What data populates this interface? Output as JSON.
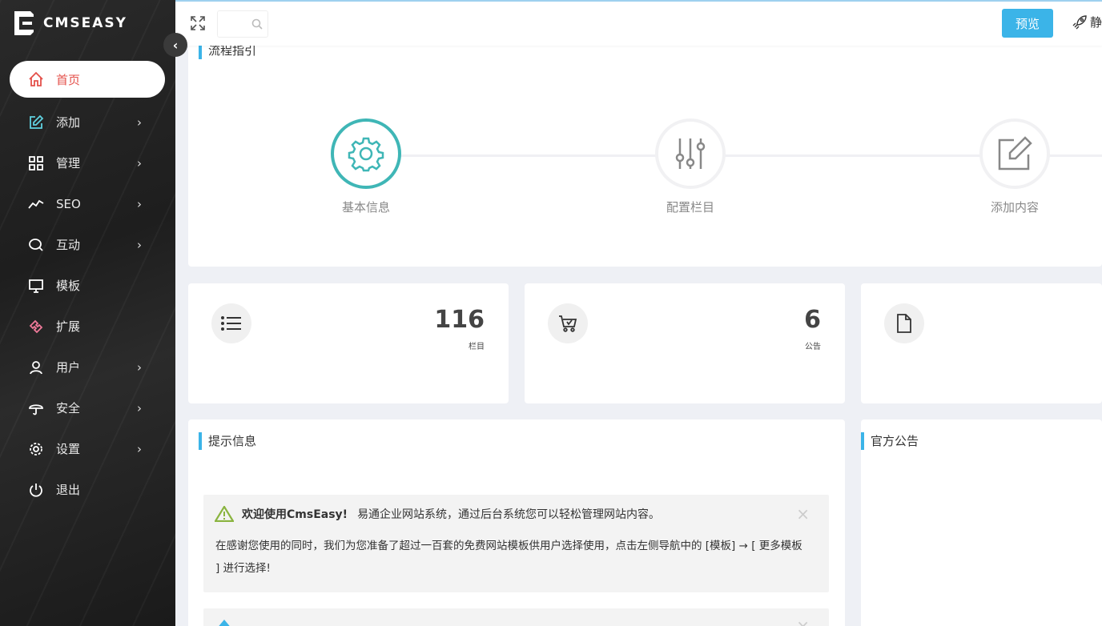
{
  "app": {
    "logo_text": "CMSEASY"
  },
  "sidebar": {
    "items": [
      {
        "label": "首页",
        "icon": "home-icon"
      },
      {
        "label": "添加",
        "icon": "edit-icon"
      },
      {
        "label": "管理",
        "icon": "grid-icon"
      },
      {
        "label": "SEO",
        "icon": "trend-icon"
      },
      {
        "label": "互动",
        "icon": "chat-icon"
      },
      {
        "label": "模板",
        "icon": "monitor-icon"
      },
      {
        "label": "扩展",
        "icon": "puzzle-icon"
      },
      {
        "label": "用户",
        "icon": "user-icon"
      },
      {
        "label": "安全",
        "icon": "umbrella-icon"
      },
      {
        "label": "设置",
        "icon": "gear-icon"
      },
      {
        "label": "退出",
        "icon": "power-icon"
      }
    ]
  },
  "topbar": {
    "search_placeholder": "",
    "preview_label": "预览",
    "static_label": "静"
  },
  "flow": {
    "title": "流程指引",
    "steps": [
      {
        "label": "基本信息"
      },
      {
        "label": "配置栏目"
      },
      {
        "label": "添加内容"
      }
    ]
  },
  "stats": [
    {
      "value": "116",
      "caption": "栏目"
    },
    {
      "value": "6",
      "caption": "公告"
    },
    {
      "value": "",
      "caption": ""
    }
  ],
  "tips": {
    "title": "提示信息",
    "alert1": {
      "heading": "欢迎使用CmsEasy!",
      "subheading": "易通企业网站系统，通过后台系统您可以轻松管理网站内容。",
      "body": "在感谢您使用的同时，我们为您准备了超过一百套的免费网站模板供用户选择使用，点击左侧导航中的 [模板] → [ 更多模板 ] 进行选择!"
    }
  },
  "notice": {
    "title": "官方公告"
  },
  "colors": {
    "accent": "#3bb4e8",
    "active_menu": "#e4514b",
    "teal": "#3fb6b6"
  }
}
